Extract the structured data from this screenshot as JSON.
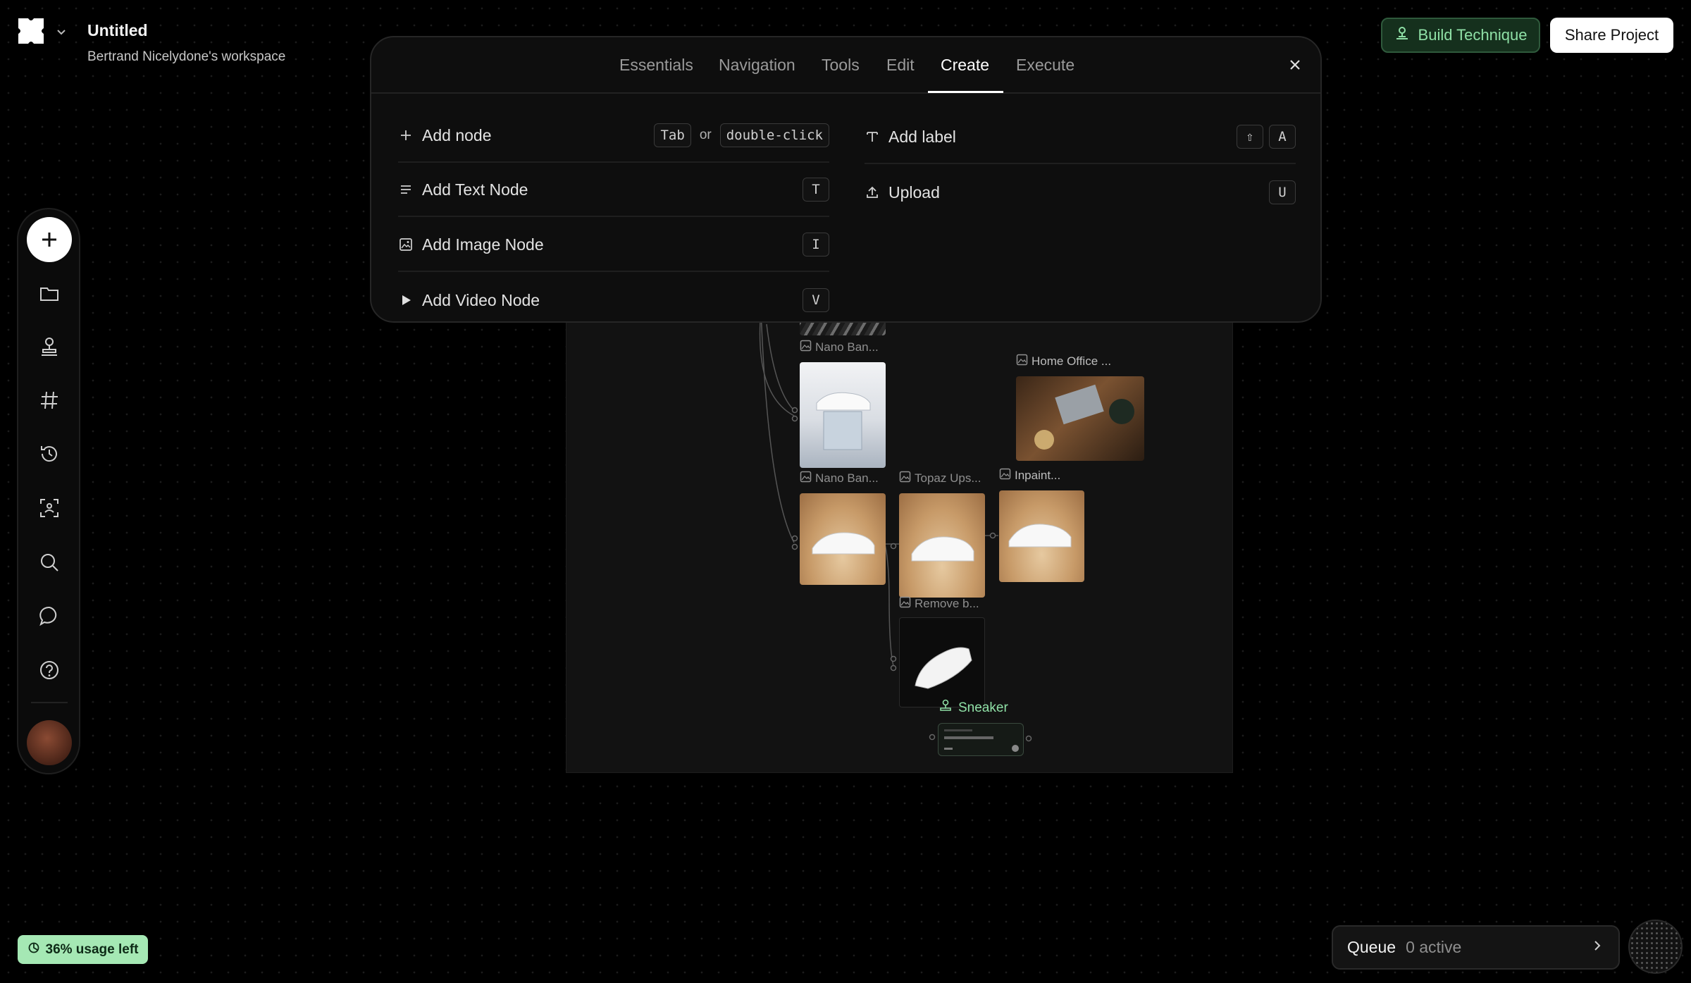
{
  "header": {
    "title": "Untitled",
    "workspace": "Bertrand Nicelydone's workspace",
    "build_label": "Build Technique",
    "share_label": "Share Project"
  },
  "rail": {
    "items": [
      "add",
      "folder",
      "person",
      "hashtag",
      "history",
      "scan",
      "search",
      "chat",
      "help"
    ]
  },
  "board": {
    "labels": {
      "nano1": "Nano Ban...",
      "nano2": "Nano Ban...",
      "home_office": "Home Office ...",
      "topaz": "Topaz Ups...",
      "inpaint": "Inpaint...",
      "remove_bg": "Remove b...",
      "sneaker": "Sneaker"
    }
  },
  "shortcuts": {
    "tabs": [
      "Essentials",
      "Navigation",
      "Tools",
      "Edit",
      "Create",
      "Execute"
    ],
    "active_tab": "Create",
    "left": [
      {
        "label": "Add node",
        "keys": [
          "Tab"
        ],
        "or": "or",
        "alt": "double-click"
      },
      {
        "label": "Add Text Node",
        "keys": [
          "T"
        ]
      },
      {
        "label": "Add Image Node",
        "keys": [
          "I"
        ]
      },
      {
        "label": "Add Video Node",
        "keys": [
          "V"
        ]
      }
    ],
    "right": [
      {
        "label": "Add label",
        "keys": [
          "⇧",
          "A"
        ]
      },
      {
        "label": "Upload",
        "keys": [
          "U"
        ]
      }
    ]
  },
  "footer": {
    "usage": "36% usage left",
    "queue_label": "Queue",
    "queue_active": "0 active"
  },
  "colors": {
    "accent_green": "#8fe0a6",
    "usage_bg": "#a5e8b4"
  }
}
